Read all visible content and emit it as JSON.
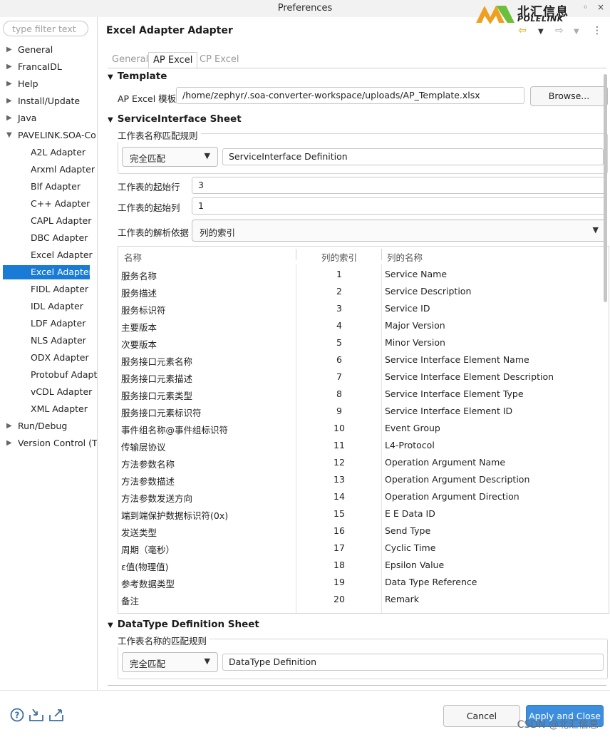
{
  "window": {
    "title": "Preferences",
    "logo_cn": "北汇信息",
    "logo_en": "POLELINK",
    "minimize_glyph": "◦",
    "close_glyph": "×"
  },
  "sidebar": {
    "filter_placeholder": "type filter text",
    "items": [
      {
        "label": "General",
        "expandable": true
      },
      {
        "label": "FrancaIDL",
        "expandable": true
      },
      {
        "label": "Help",
        "expandable": true
      },
      {
        "label": "Install/Update",
        "expandable": true
      },
      {
        "label": "Java",
        "expandable": true
      },
      {
        "label": "PAVELINK.SOA-Co",
        "expandable": true,
        "expanded": true
      },
      {
        "label": "A2L Adapter"
      },
      {
        "label": "Arxml Adapter"
      },
      {
        "label": "Blf Adapter"
      },
      {
        "label": "C++ Adapter"
      },
      {
        "label": "CAPL Adapter"
      },
      {
        "label": "DBC Adapter"
      },
      {
        "label": "Excel Adapter"
      },
      {
        "label": "Excel Adapter A",
        "selected": true
      },
      {
        "label": "FIDL Adapter"
      },
      {
        "label": "IDL Adapter"
      },
      {
        "label": "LDF Adapter"
      },
      {
        "label": "NLS Adapter"
      },
      {
        "label": "ODX Adapter"
      },
      {
        "label": "Protobuf Adapt"
      },
      {
        "label": "vCDL Adapter"
      },
      {
        "label": "XML Adapter"
      },
      {
        "label": "Run/Debug",
        "expandable": true
      },
      {
        "label": "Version Control (T",
        "expandable": true
      }
    ]
  },
  "main": {
    "title": "Excel Adapter Adapter",
    "nav_icons": [
      "back-arrow-icon",
      "dropdown-icon",
      "forward-arrow-icon",
      "dropdown-icon",
      "more-icon"
    ],
    "tabs": [
      "General",
      "AP Excel",
      "CP Excel"
    ],
    "active_tab": "AP Excel",
    "template": {
      "heading": "Template",
      "label": "AP Excel 模板",
      "path": "/home/zephyr/.soa-converter-workspace/uploads/AP_Template.xlsx",
      "browse": "Browse..."
    },
    "service_interface": {
      "heading": "ServiceInterface Sheet",
      "match_rule_label": "工作表名称匹配规则",
      "match_mode": "完全匹配",
      "sheet_name": "ServiceInterface Definition",
      "start_row_label": "工作表的起始行",
      "start_row": "3",
      "start_col_label": "工作表的起始列",
      "start_col": "1",
      "parse_basis_label": "工作表的解析依据",
      "parse_basis": "列的索引"
    },
    "table": {
      "headers": [
        "名称",
        "列的索引",
        "列的名称"
      ],
      "rows": [
        [
          "服务名称",
          "1",
          "Service Name"
        ],
        [
          "服务描述",
          "2",
          "Service Description"
        ],
        [
          "服务标识符",
          "3",
          "Service ID"
        ],
        [
          "主要版本",
          "4",
          "Major Version"
        ],
        [
          "次要版本",
          "5",
          "Minor Version"
        ],
        [
          "服务接口元素名称",
          "6",
          "Service Interface Element Name"
        ],
        [
          "服务接口元素描述",
          "7",
          "Service Interface Element Description"
        ],
        [
          "服务接口元素类型",
          "8",
          "Service Interface Element Type"
        ],
        [
          "服务接口元素标识符",
          "9",
          "Service Interface Element ID"
        ],
        [
          "事件组名称@事件组标识符",
          "10",
          "Event Group"
        ],
        [
          "传输层协议",
          "11",
          "L4-Protocol"
        ],
        [
          "方法参数名称",
          "12",
          "Operation Argument Name"
        ],
        [
          "方法参数描述",
          "13",
          "Operation Argument Description"
        ],
        [
          "方法参数发送方向",
          "14",
          "Operation Argument Direction"
        ],
        [
          "端到端保护数据标识符(0x)",
          "15",
          "E E Data ID"
        ],
        [
          "发送类型",
          "16",
          "Send Type"
        ],
        [
          "周期（毫秒）",
          "17",
          "Cyclic Time"
        ],
        [
          "ε值(物理值)",
          "18",
          "Epsilon Value"
        ],
        [
          "参考数据类型",
          "19",
          "Data Type Reference"
        ],
        [
          "备注",
          "20",
          "Remark"
        ]
      ]
    },
    "datatype": {
      "heading": "DataType Definition Sheet",
      "match_rule_label": "工作表名称的匹配规则",
      "match_mode": "完全匹配",
      "sheet_name": "DataType Definition"
    }
  },
  "footer": {
    "icons": [
      "help-icon",
      "import-icon",
      "export-icon"
    ],
    "cancel": "Cancel",
    "apply_close": "Apply and Close",
    "watermark": "CSDN @北汇信息"
  },
  "colors": {
    "selection": "#1a7bd6",
    "apply_button": "#3d8ede",
    "logo_orange": "#f0a020",
    "logo_green": "#6cbf3a"
  }
}
